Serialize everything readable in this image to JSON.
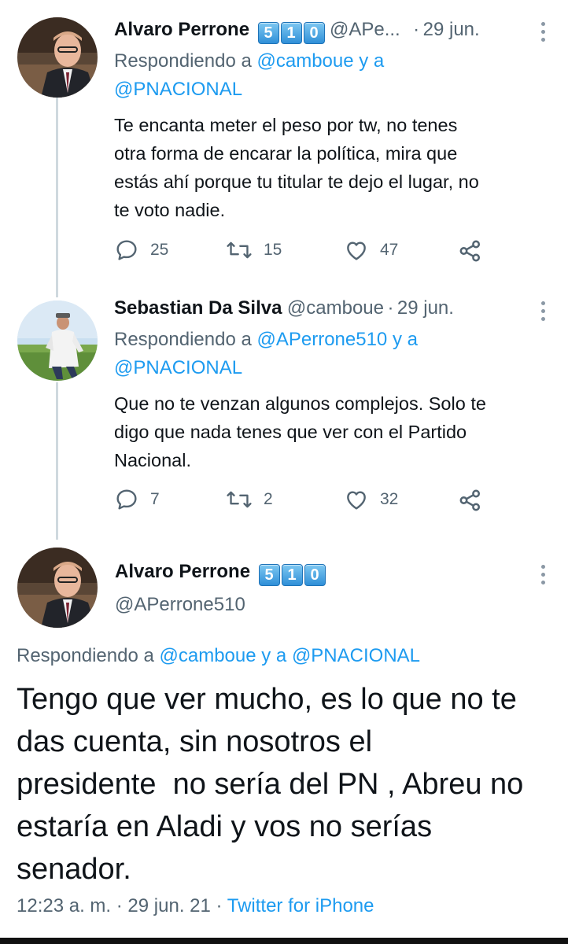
{
  "tweets": [
    {
      "name": "Alvaro Perrone",
      "badges": [
        "5",
        "1",
        "0"
      ],
      "handle": "@APe...",
      "separator": "·",
      "date": "29 jun.",
      "replying_prefix": "Respondiendo a",
      "replying_to_1": "@camboue",
      "replying_and": "y a",
      "replying_to_2": "@PNACIONAL",
      "text_lines": [
        "Te encanta meter el peso por tw, no tenes",
        "otra forma de encarar la política, mira que",
        "estás ahí porque tu titular te dejo el lugar, no",
        "te voto nadie."
      ],
      "replies": "25",
      "retweets": "15",
      "likes": "47"
    },
    {
      "name": "Sebastian Da Silva",
      "handle": "@camboue",
      "separator": "·",
      "date": "29 jun.",
      "replying_prefix": "Respondiendo a",
      "replying_to_1": "@APerrone510",
      "replying_and": "y a",
      "replying_to_2": "@PNACIONAL",
      "text_lines": [
        "Que no te venzan algunos complejos. Solo te",
        "digo que nada tenes que ver con el Partido",
        "Nacional."
      ],
      "replies": "7",
      "retweets": "2",
      "likes": "32"
    }
  ],
  "main_tweet": {
    "name": "Alvaro Perrone",
    "badges": [
      "5",
      "1",
      "0"
    ],
    "handle": "@APerrone510",
    "replying_prefix": "Respondiendo a",
    "replying_to_1": "@camboue",
    "replying_and": "y a",
    "replying_to_2": "@PNACIONAL",
    "text_lines": [
      "Tengo que ver mucho, es lo que no te",
      "das cuenta, sin nosotros el",
      "presidente  no sería del PN , Abreu no",
      "estaría en Aladi y vos no serías",
      "senador."
    ],
    "time": "12:23 a. m.",
    "separator": "·",
    "date": "29 jun. 21",
    "source": "Twitter for iPhone"
  },
  "icons": {
    "reply": "reply-icon",
    "retweet": "retweet-icon",
    "like": "like-icon",
    "share": "share-icon",
    "more": "more-icon"
  },
  "colors": {
    "link": "#1d9bf0",
    "secondary_text": "#536471",
    "thread_line": "#cfd9de"
  }
}
